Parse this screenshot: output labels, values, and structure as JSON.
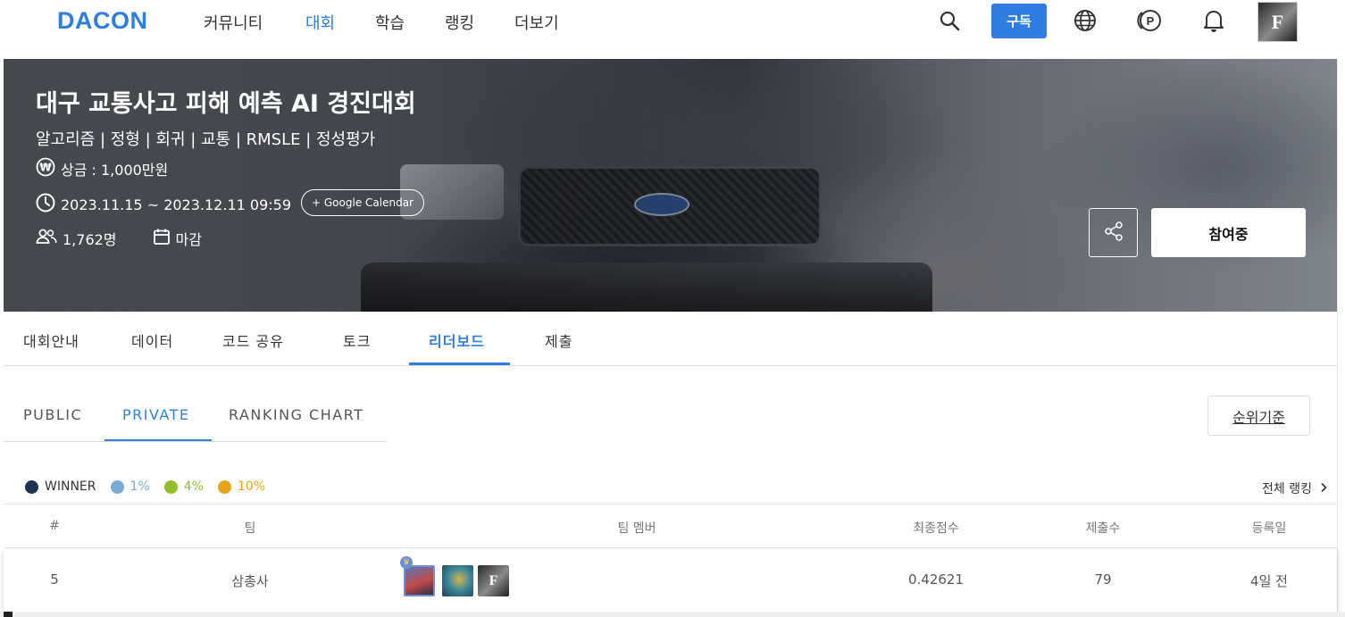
{
  "nav": {
    "logo": "DACON",
    "items": [
      "커뮤니티",
      "대회",
      "학습",
      "랭킹",
      "더보기"
    ],
    "active_index": 1,
    "subscribe_label": "구독",
    "avatar_text": "F"
  },
  "hero": {
    "title": "대구 교통사고 피해 예측 AI 경진대회",
    "tags": "알고리즘 | 정형 | 회귀 | 교통 | RMSLE | 정성평가",
    "prize": "상금 : 1,000만원",
    "period": "2023.11.15 ~ 2023.12.11 09:59",
    "calendar_label": "+ Google Calendar",
    "participants": "1,762명",
    "status": "마감",
    "join_label": "참여중"
  },
  "comp_tabs": [
    "대회안내",
    "데이터",
    "코드 공유",
    "토크",
    "리더보드",
    "제출"
  ],
  "comp_tab_active": "리더보드",
  "leaderboard": {
    "tabs": [
      "PUBLIC",
      "PRIVATE",
      "RANKING CHART"
    ],
    "active_tab": "PRIVATE",
    "rank_basis_label": "순위기준",
    "legend": [
      {
        "label": "WINNER",
        "color": "#1f3352"
      },
      {
        "label": "1%",
        "color": "#7aaad6"
      },
      {
        "label": "4%",
        "color": "#8fbf2a"
      },
      {
        "label": "10%",
        "color": "#e8a317"
      }
    ],
    "full_ranking_label": "전체 랭킹",
    "columns": [
      "#",
      "팀",
      "팀 멤버",
      "최종점수",
      "제출수",
      "등록일"
    ],
    "rows": [
      {
        "rank": "5",
        "team": "삼총사",
        "score": "0.42621",
        "submissions": "79",
        "registered": "4일 전"
      }
    ]
  },
  "colors": {
    "accent": "#2f7de1"
  }
}
